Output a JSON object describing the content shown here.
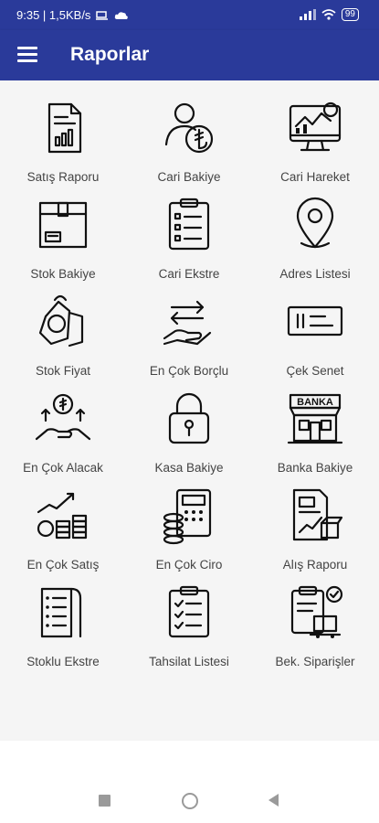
{
  "status_bar": {
    "time_speed": "9:35 | 1,5KB/s",
    "battery": "99"
  },
  "app_bar": {
    "title": "Raporlar"
  },
  "reports": [
    {
      "label": "Satış Raporu",
      "icon": "sales-report-icon"
    },
    {
      "label": "Cari Bakiye",
      "icon": "account-balance-icon"
    },
    {
      "label": "Cari Hareket",
      "icon": "account-movement-icon"
    },
    {
      "label": "Stok Bakiye",
      "icon": "stock-box-icon"
    },
    {
      "label": "Cari Ekstre",
      "icon": "clipboard-list-icon"
    },
    {
      "label": "Adres Listesi",
      "icon": "map-pin-icon"
    },
    {
      "label": "Stok Fiyat",
      "icon": "price-tag-icon"
    },
    {
      "label": "En Çok Borçlu",
      "icon": "money-hand-icon"
    },
    {
      "label": "Çek Senet",
      "icon": "check-icon"
    },
    {
      "label": "En Çok Alacak",
      "icon": "growth-coins-icon"
    },
    {
      "label": "Kasa Bakiye",
      "icon": "padlock-icon"
    },
    {
      "label": "Banka Bakiye",
      "icon": "bank-icon"
    },
    {
      "label": "En Çok Satış",
      "icon": "sales-growth-icon"
    },
    {
      "label": "En Çok Ciro",
      "icon": "calculator-coins-icon"
    },
    {
      "label": "Alış Raporu",
      "icon": "purchase-report-icon"
    },
    {
      "label": "Stoklu Ekstre",
      "icon": "ledger-icon"
    },
    {
      "label": "Tahsilat Listesi",
      "icon": "checklist-icon"
    },
    {
      "label": "Bek. Siparişler",
      "icon": "pending-orders-icon"
    }
  ]
}
